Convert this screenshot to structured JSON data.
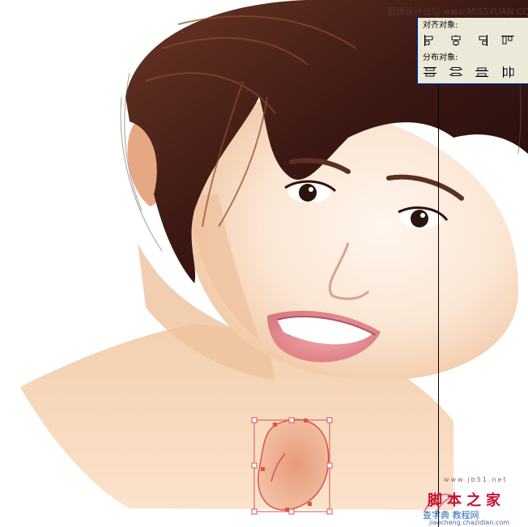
{
  "watermark": {
    "forum_text": "思缘设计论坛",
    "forum_url": "www.MISSYUAN.COM",
    "site_url_small": "www.jb51.net",
    "site_name": "脚本之家",
    "site_tagline": "查字典 教程网",
    "site_url_bottom": "jiaocheng.chazidian.com"
  },
  "align_panel": {
    "align_label": "对齐对象:",
    "distribute_label": "分布对象:",
    "align_buttons": [
      {
        "icon": "align-left-icon"
      },
      {
        "icon": "align-horizontal-center-icon"
      },
      {
        "icon": "align-right-icon"
      },
      {
        "icon": "align-top-icon"
      }
    ],
    "distribute_buttons": [
      {
        "icon": "distribute-top-icon"
      },
      {
        "icon": "distribute-vertical-center-icon"
      },
      {
        "icon": "distribute-bottom-icon"
      },
      {
        "icon": "distribute-left-icon"
      }
    ]
  },
  "colors": {
    "hair": "#3a1a12",
    "skin": "#f6d9bd",
    "skin_shadow": "#e9b08c",
    "selection": "#d9534f",
    "panel_bg": "#ece9d8",
    "panel_border": "#0a246a",
    "logo_red": "#c8102e"
  }
}
